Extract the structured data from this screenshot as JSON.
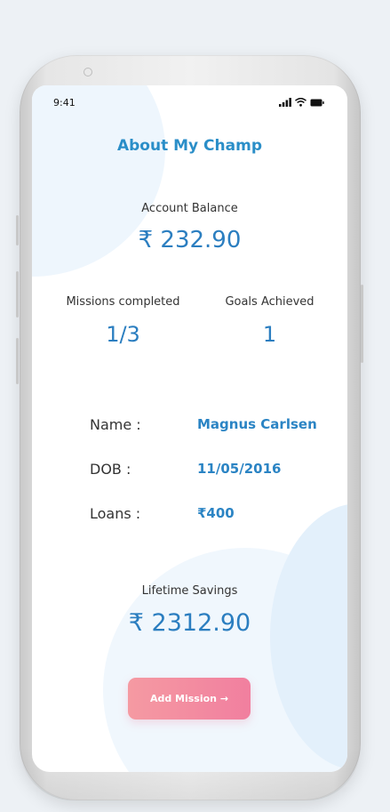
{
  "status_bar": {
    "time": "9:41",
    "icons": [
      "signal-icon",
      "wifi-icon",
      "battery-icon"
    ]
  },
  "header": {
    "title": "About My Champ"
  },
  "account": {
    "label": "Account Balance",
    "value": "₹ 232.90"
  },
  "stats": {
    "missions": {
      "label": "Missions completed",
      "value": "1/3"
    },
    "goals": {
      "label": "Goals Achieved",
      "value": "1"
    }
  },
  "info": [
    {
      "key": "Name :",
      "value": "Magnus Carlsen"
    },
    {
      "key": "DOB :",
      "value": "11/05/2016"
    },
    {
      "key": "Loans :",
      "value": "₹400"
    }
  ],
  "savings": {
    "label": "Lifetime Savings",
    "value": "₹ 2312.90"
  },
  "actions": {
    "add_mission": "Add Mission →"
  },
  "colors": {
    "accent": "#2b84c4",
    "title": "#2a8ec8",
    "button_start": "#f59aa2",
    "button_end": "#f17f9f",
    "background": "#edf1f5"
  }
}
